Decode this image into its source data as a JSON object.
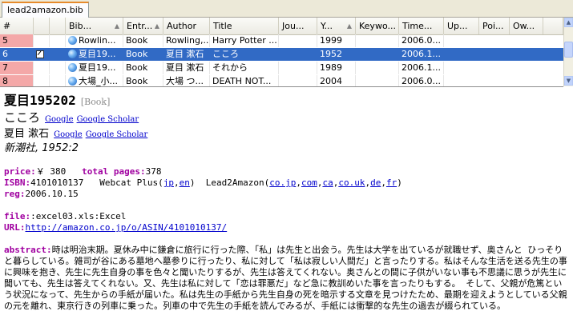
{
  "tab": {
    "label": "lead2amazon.bib"
  },
  "table": {
    "columns": [
      {
        "label": "#"
      },
      {
        "label": ""
      },
      {
        "label": ""
      },
      {
        "label": "Bib..."
      },
      {
        "label": "Entr..."
      },
      {
        "label": "Author"
      },
      {
        "label": "Title"
      },
      {
        "label": "Jou..."
      },
      {
        "label": "Y..."
      },
      {
        "label": "Keywo..."
      },
      {
        "label": "Time..."
      },
      {
        "label": "Up..."
      },
      {
        "label": "Poi..."
      },
      {
        "label": "Ow..."
      },
      {
        "label": ""
      }
    ],
    "rows": [
      {
        "num": "5",
        "bib": "Rowlin...",
        "entry": "Book",
        "author": "Rowling,...",
        "title": "Harry Potter ...",
        "year": "1999",
        "time": "2006.0...",
        "selected": false
      },
      {
        "num": "6",
        "bib": "夏目19...",
        "entry": "Book",
        "author": "夏目 漱石",
        "title": "こころ",
        "year": "1952",
        "time": "2006.1...",
        "selected": true
      },
      {
        "num": "7",
        "bib": "夏目19...",
        "entry": "Book",
        "author": "夏目 漱石",
        "title": "それから",
        "year": "1989",
        "time": "2006.1...",
        "selected": false
      },
      {
        "num": "8",
        "bib": "大場_小...",
        "entry": "Book",
        "author": "大場 つ...",
        "title": "DEATH NOT...",
        "year": "2004",
        "time": "2006.0...",
        "selected": false
      }
    ]
  },
  "detail": {
    "key": "夏目195202",
    "type": "[Book]",
    "title": "こころ",
    "author": "夏目 漱石",
    "google": "Google",
    "google_scholar": "Google Scholar",
    "publisher": "新潮社, 1952:2",
    "price_label": "price:",
    "price": "￥ 380",
    "pages_label": "total pages:",
    "pages": "378",
    "isbn_label": "ISBN:",
    "isbn": "4101010137",
    "webcat": "Webcat Plus(",
    "webcat_jp": "jp",
    "comma": ",",
    "webcat_en": "en",
    "close": ")",
    "l2a": "Lead2Amazon(",
    "l2a_links": [
      "co.jp",
      "com",
      "ca",
      "co.uk",
      "de",
      "fr"
    ],
    "reg_label": "reg:",
    "reg": "2006.10.15",
    "file_label": "file:",
    "file": ":excel03.xls:Excel",
    "url_label": "URL:",
    "url": "http://amazon.co.jp/o/ASIN/4101010137/",
    "abstract_label": "abstract:",
    "abstract": "時は明治末期。夏休み中に鎌倉に旅行に行った際、「私」は先生と出会う。先生は大学を出ているが就職せず、奥さんと ひっそりと暮らしている。雑司が谷にある墓地へ墓参りに行ったり、私に対して「私は寂しい人間だ」と言ったりする。私はそんな生活を送る先生の事に興味を抱き、先生に先生自身の事を色々と聞いたりするが、先生は答えてくれない。奥さんとの間に子供がいない事も不思議に思うが先生に聞いても、先生は答えてくれない。又、先生は私に対して「恋は罪悪だ」など急に教訓めいた事を言ったりもする。 そして、父親が危篤という状況になって、先生からの手紙が届いた。私は先生の手紙から先生自身の死を暗示する文章を見つけたため、最期を迎えようとしている父親の元を離れ、東京行きの列車に乗った。列車の中で先生の手紙を読んでみるが、手紙には衝撃的な先生の過去が綴られている。"
  },
  "colors": {
    "selection": "#316ac5",
    "rownum": "#f4a8a8",
    "key": "#a000a0",
    "link": "#0000cc",
    "tab_accent": "#e68b2c"
  }
}
